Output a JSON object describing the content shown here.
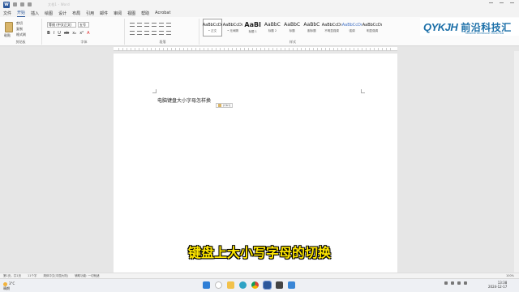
{
  "window": {
    "app_icon_label": "W",
    "doc_title": "文档1 - Word"
  },
  "menu": {
    "tabs": [
      "文件",
      "开始",
      "插入",
      "绘图",
      "设计",
      "布局",
      "引用",
      "邮件",
      "审阅",
      "视图",
      "帮助",
      "Acrobat"
    ]
  },
  "ribbon": {
    "clipboard": {
      "paste_label": "粘贴",
      "cut_label": "剪切",
      "copy_label": "复制",
      "format_painter_label": "格式刷",
      "group_label": "剪贴板"
    },
    "font": {
      "font_name": "等线 (中文正文)",
      "font_size": "五号",
      "bold": "B",
      "italic": "I",
      "underline": "U",
      "strike": "ab",
      "subscript": "x₂",
      "superscript": "x²",
      "color_a": "A",
      "group_label": "字体"
    },
    "paragraph": {
      "group_label": "段落"
    },
    "styles": {
      "items": [
        {
          "preview": "AaBbCcDı",
          "name": "• 正文"
        },
        {
          "preview": "AaBbCcDı",
          "name": "• 无间隔"
        },
        {
          "preview": "AaBl",
          "name": "标题 1"
        },
        {
          "preview": "AaBbC",
          "name": "标题 2"
        },
        {
          "preview": "AaBbC",
          "name": "标题"
        },
        {
          "preview": "AaBbC",
          "name": "副标题"
        },
        {
          "preview": "AaBbCcDı",
          "name": "不明显强调"
        },
        {
          "preview": "AaBbCcDı",
          "name": "强调"
        },
        {
          "preview": "AaBbCcDı",
          "name": "明显强调"
        }
      ],
      "group_label": "样式"
    }
  },
  "brand": {
    "mark": "QYKJH",
    "chinese": "前沿科技汇",
    "tagline": "FRONTIER TECHNOLOGY COLLECTION"
  },
  "document": {
    "text": "电脑键盘大小字母怎样换",
    "paste_options_label": "(Ctrl)"
  },
  "subtitle": "键盘上大小写字母的切换",
  "statusbar": {
    "page": "第1页，共1页",
    "words": "11个字",
    "language": "简体中文(中国大陆)",
    "accessibility": "辅助功能: 一切就绪",
    "zoom": "100%"
  },
  "taskbar": {
    "temperature": "3°C",
    "weather": "晴朗",
    "time": "13:38",
    "date": "2024-12-17"
  }
}
